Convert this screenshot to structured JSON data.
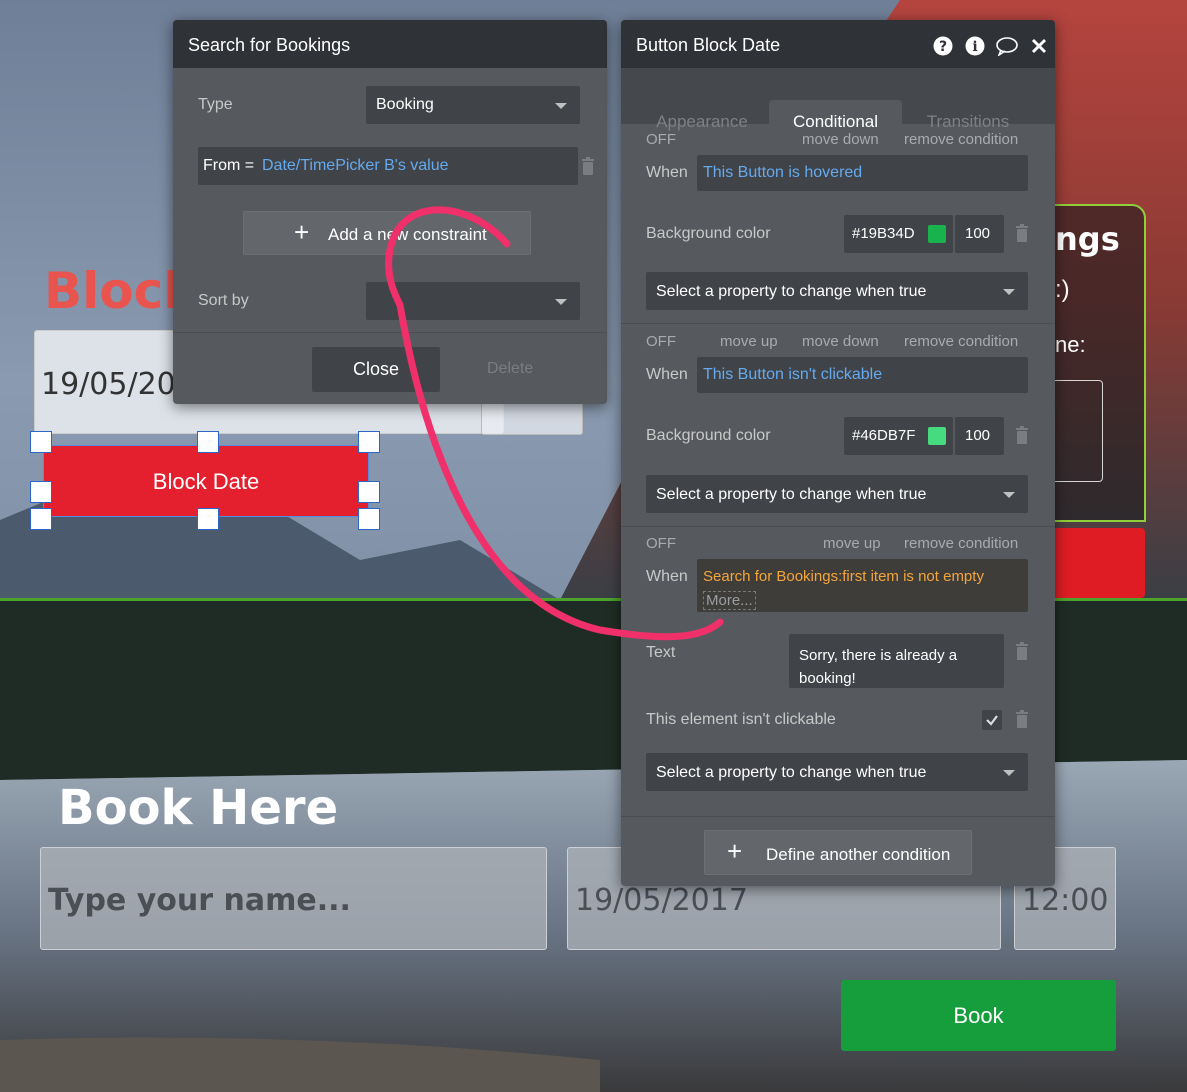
{
  "page": {
    "block_title": "Block",
    "top_date_value": "19/05/20",
    "block_date_button": "Block Date",
    "right_card_title": "ngs",
    "right_card_sub": ":)",
    "right_card_label": "ne:",
    "book_here": "Book Here",
    "name_placeholder": "Type your name...",
    "date_value": "19/05/2017",
    "time_value": "12:00",
    "book_button": "Book"
  },
  "search_panel": {
    "title": "Search for Bookings",
    "type_label": "Type",
    "type_value": "Booking",
    "from_label": "From =",
    "from_value": "Date/TimePicker B's value",
    "add_constraint": "Add a new constraint",
    "sort_label": "Sort by",
    "sort_value": "",
    "close_button": "Close",
    "delete_button": "Delete"
  },
  "props_panel": {
    "title": "Button Block Date",
    "header_icons": [
      "help-icon",
      "info-icon",
      "comment-icon",
      "close-icon"
    ],
    "tabs": [
      "Appearance",
      "Conditional",
      "Transitions"
    ],
    "active_tab": "Conditional",
    "conditions": [
      {
        "status": "OFF",
        "actions": [
          "move down",
          "remove condition"
        ],
        "when_label": "When",
        "when_value": "This Button is hovered",
        "property_label": "Background color",
        "color_hex": "#19B34D",
        "opacity": "100",
        "select_placeholder": "Select a property to change when true"
      },
      {
        "status": "OFF",
        "actions": [
          "move up",
          "move down",
          "remove condition"
        ],
        "when_label": "When",
        "when_value": "This Button isn't clickable",
        "property_label": "Background color",
        "color_hex": "#46DB7F",
        "opacity": "100",
        "select_placeholder": "Select a property to change when true"
      },
      {
        "status": "OFF",
        "actions": [
          "move up",
          "remove condition"
        ],
        "when_label": "When",
        "when_value": "Search for Bookings:first item is not empty",
        "when_more": "More...",
        "text_label": "Text",
        "text_value": "Sorry, there is already a booking!",
        "clickable_label": "This element isn't clickable",
        "clickable_checked": true,
        "select_placeholder": "Select a property to change when true"
      }
    ],
    "define_condition": "Define another condition"
  },
  "colors": {
    "hover_green": "#19B34D",
    "unclickable_green": "#46DB7F",
    "block_red": "#E4202F",
    "book_green": "#169D3C",
    "annotation_pink": "#F0306A"
  }
}
